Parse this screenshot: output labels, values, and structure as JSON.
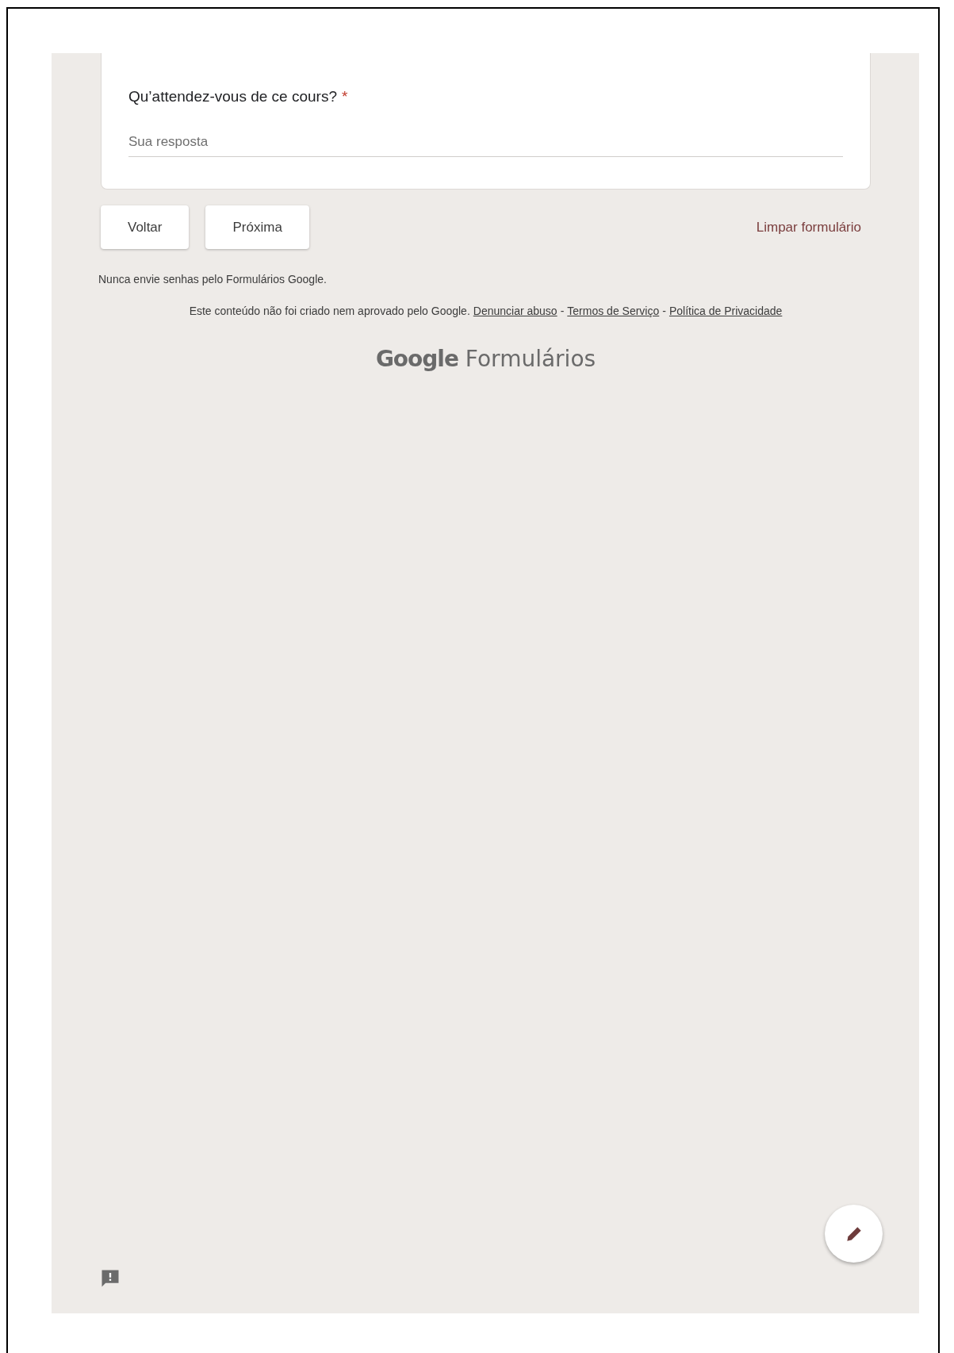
{
  "question": {
    "title": "Qu’attendez-vous de ce cours?",
    "required": true,
    "required_mark": "*",
    "placeholder": "Sua resposta"
  },
  "buttons": [
    {
      "label": "Voltar"
    },
    {
      "label": "Próxima"
    }
  ],
  "clear_link": "Limpar formulário",
  "warning": "Nunca envie senhas pelo Formulários Google.",
  "footer": {
    "text": "Este conteúdo não foi criado nem aprovado pelo Google.",
    "separator": "-",
    "links": [
      "Denunciar abuso",
      "Termos de Serviço",
      "Política de Privacidade"
    ]
  },
  "logo": {
    "brand": "Google",
    "product": "Formulários"
  }
}
